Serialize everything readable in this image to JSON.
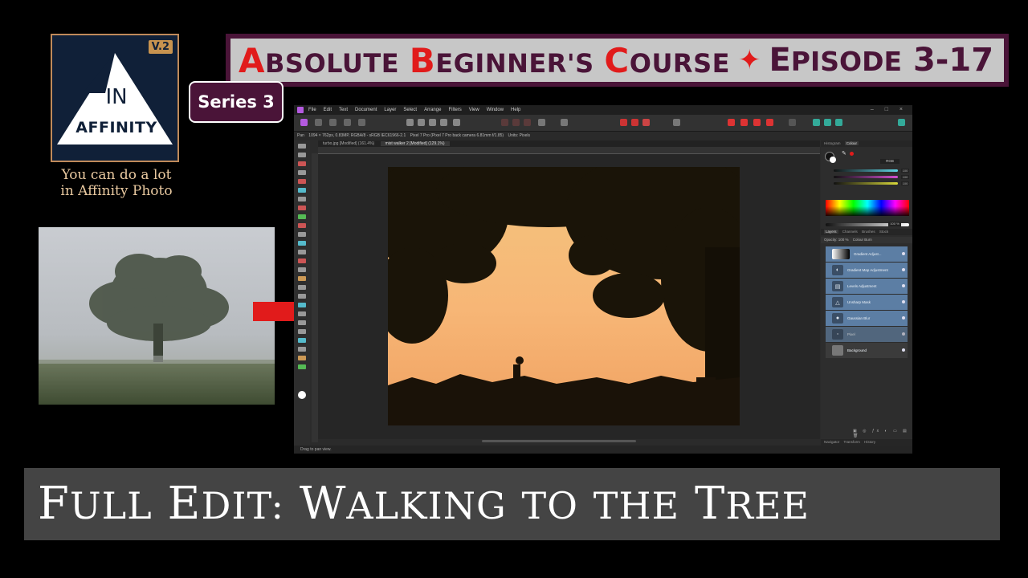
{
  "logo": {
    "version_badge": "V.2",
    "line1": "IN",
    "line2": "AFFINITY"
  },
  "tagline": [
    "You can do a lot",
    "in Affinity Photo"
  ],
  "series_badge": "Series 3",
  "banner": {
    "course_title": [
      {
        "initial": "A",
        "rest": "bsolute"
      },
      {
        "initial": "B",
        "rest": "eginner's"
      },
      {
        "initial": "C",
        "rest": "ourse"
      }
    ],
    "star": "✦",
    "episode": [
      {
        "initial": "E",
        "rest": "pisode"
      },
      {
        "initial": "3-17",
        "rest": ""
      }
    ]
  },
  "app": {
    "menu_items": [
      "File",
      "Edit",
      "Text",
      "Document",
      "Layer",
      "Select",
      "Arrange",
      "Filters",
      "View",
      "Window",
      "Help"
    ],
    "window_controls": "– □ ×",
    "context_bar": [
      "Pan",
      "1094 × 762px, 0.83MP, RGBA/8 - sRGB IEC61966-2.1",
      "Pixel 7 Pro (Pixel 7 Pro back camera 6.81mm f/1.85)",
      "Units: Pixels"
    ],
    "doc_tabs": [
      {
        "label": "turbo.jpg [Modified] (161.4%)",
        "active": false
      },
      {
        "label": "mist walker 2 [Modified] (129.1%)",
        "active": true
      }
    ],
    "status_text": "Drag to pan view.",
    "colour_panel": {
      "tabs": [
        "Histogram",
        "Colour"
      ],
      "mode": "RGB",
      "sliders": [
        {
          "label": "R",
          "value": "100",
          "color": "#5fd6e6"
        },
        {
          "label": "G",
          "value": "100",
          "color": "#d24fd0"
        },
        {
          "label": "B",
          "value": "100",
          "color": "#d8d83a"
        }
      ],
      "opacity_value": "100 %"
    },
    "layers_panel": {
      "tabs": [
        "Layers",
        "Channels",
        "Brushes",
        "Stock"
      ],
      "opacity": "Opacity: 100 %",
      "blend_mode": "Colour Burn",
      "layers": [
        {
          "name": "Gradient Adjust...",
          "icon": "gradient-map-icon",
          "selected": true
        },
        {
          "name": "Gradient Map Adjustment",
          "icon": "gradient-icon",
          "selected": true
        },
        {
          "name": "Levels Adjustment",
          "icon": "levels-icon",
          "selected": true
        },
        {
          "name": "Unsharp Mask",
          "icon": "unsharp-icon",
          "selected": true
        },
        {
          "name": "Gaussian Blur",
          "icon": "blur-icon",
          "selected": true
        },
        {
          "name": "Pixel",
          "icon": "pixel-icon",
          "selected": false
        },
        {
          "name": "Background",
          "icon": "background-icon",
          "selected": false
        }
      ],
      "bottom_tabs": [
        "Navigator",
        "Transform",
        "History"
      ]
    }
  },
  "bottom_title": [
    {
      "initial": "F",
      "rest": "ull"
    },
    {
      "initial": "E",
      "rest": "dit:"
    },
    {
      "initial": "W",
      "rest": "alking"
    },
    {
      "initial": "",
      "rest": "to"
    },
    {
      "initial": "",
      "rest": "the"
    },
    {
      "initial": "T",
      "rest": "ree"
    }
  ],
  "colors": {
    "brand_purple": "#4a1438",
    "accent_red": "#e11b1b",
    "logo_bg": "#102038",
    "badge_gold": "#c8934f"
  }
}
